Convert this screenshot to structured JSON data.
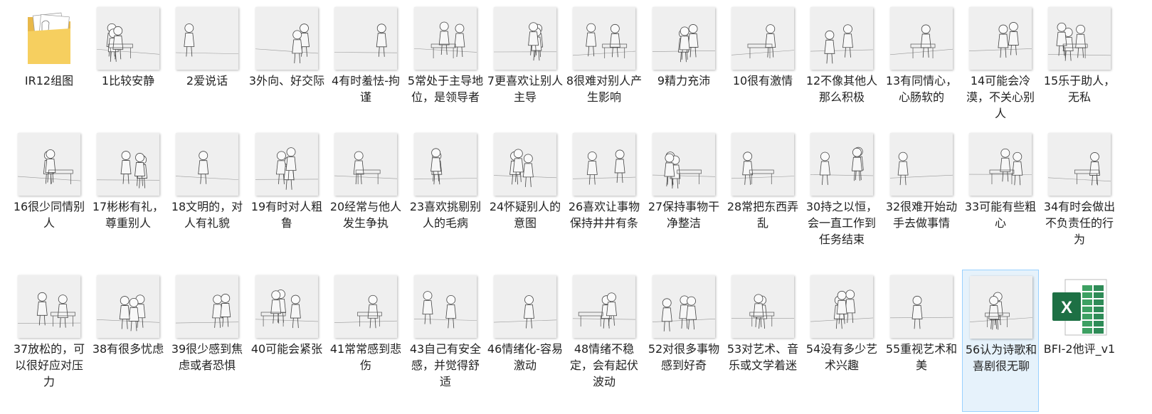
{
  "colors": {
    "background": "#ffffff",
    "label_text": "#222222",
    "selection_border": "#99d1ff",
    "selection_fill": "#e6f2fb",
    "folder": "#f6cf5f",
    "excel_green": "#1d7044"
  },
  "items": [
    {
      "label": "IR12组图",
      "kind": "folder",
      "icon": "folder-icon"
    },
    {
      "label": "1比较安静",
      "kind": "image"
    },
    {
      "label": "2爱说话",
      "kind": "image"
    },
    {
      "label": "3外向、好交际",
      "kind": "image"
    },
    {
      "label": "4有时羞怯-拘谨",
      "kind": "image"
    },
    {
      "label": "5常处于主导地位，是领导者",
      "kind": "image"
    },
    {
      "label": "7更喜欢让别人主导",
      "kind": "image"
    },
    {
      "label": "8很难对别人产生影响",
      "kind": "image"
    },
    {
      "label": "9精力充沛",
      "kind": "image"
    },
    {
      "label": "10很有激情",
      "kind": "image"
    },
    {
      "label": "12不像其他人那么积极",
      "kind": "image"
    },
    {
      "label": "13有同情心，心肠软的",
      "kind": "image"
    },
    {
      "label": "14可能会冷漠，不关心别人",
      "kind": "image"
    },
    {
      "label": "15乐于助人，无私",
      "kind": "image"
    },
    {
      "label": "16很少同情别人",
      "kind": "image"
    },
    {
      "label": "17彬彬有礼，尊重别人",
      "kind": "image"
    },
    {
      "label": "18文明的，对人有礼貌",
      "kind": "image"
    },
    {
      "label": "19有时对人粗鲁",
      "kind": "image"
    },
    {
      "label": "20经常与他人发生争执",
      "kind": "image"
    },
    {
      "label": "23喜欢挑剔别人的毛病",
      "kind": "image"
    },
    {
      "label": "24怀疑别人的意图",
      "kind": "image"
    },
    {
      "label": "26喜欢让事物保持井井有条",
      "kind": "image"
    },
    {
      "label": "27保持事物干净整洁",
      "kind": "image"
    },
    {
      "label": "28常把东西弄乱",
      "kind": "image"
    },
    {
      "label": "30持之以恒，会一直工作到任务结束",
      "kind": "image"
    },
    {
      "label": "32很难开始动手去做事情",
      "kind": "image"
    },
    {
      "label": "33可能有些粗心",
      "kind": "image"
    },
    {
      "label": "34有时会做出不负责任的行为",
      "kind": "image"
    },
    {
      "label": "37放松的，可以很好应对压力",
      "kind": "image"
    },
    {
      "label": "38有很多忧虑",
      "kind": "image"
    },
    {
      "label": "39很少感到焦虑或者恐惧",
      "kind": "image"
    },
    {
      "label": "40可能会紧张",
      "kind": "image"
    },
    {
      "label": "41常常感到悲伤",
      "kind": "image"
    },
    {
      "label": "43自己有安全感，并觉得舒适",
      "kind": "image"
    },
    {
      "label": "46情绪化-容易激动",
      "kind": "image"
    },
    {
      "label": "48情绪不稳定，会有起伏波动",
      "kind": "image"
    },
    {
      "label": "52对很多事物感到好奇",
      "kind": "image"
    },
    {
      "label": "53对艺术、音乐或文学着迷",
      "kind": "image"
    },
    {
      "label": "54没有多少艺术兴趣",
      "kind": "image"
    },
    {
      "label": "55重视艺术和美",
      "kind": "image"
    },
    {
      "label": "56认为诗歌和喜剧很无聊",
      "kind": "image",
      "selected": true
    },
    {
      "label": "BFI-2他评_v1",
      "kind": "excel",
      "icon": "excel-icon"
    }
  ]
}
